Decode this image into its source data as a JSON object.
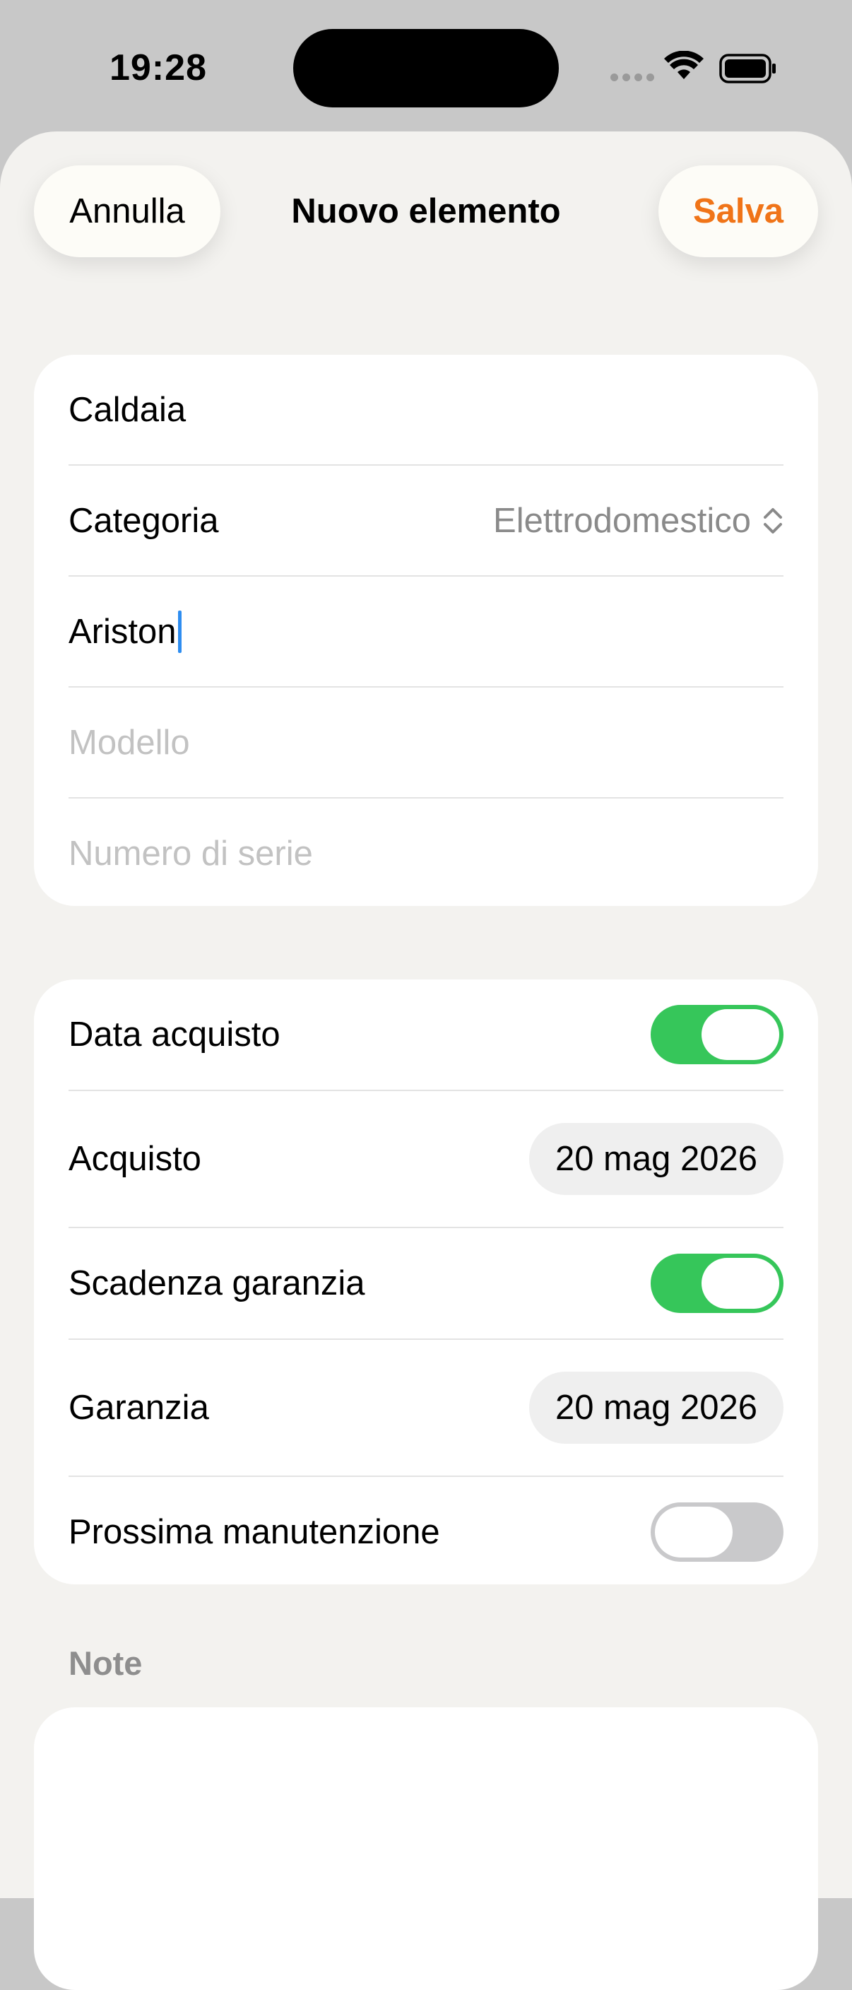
{
  "status_bar": {
    "time": "19:28",
    "signal_icon": "cellular-dots-icon",
    "wifi_icon": "wifi-icon",
    "battery_icon": "battery-icon"
  },
  "nav": {
    "cancel_label": "Annulla",
    "title": "Nuovo elemento",
    "save_label": "Salva",
    "save_color": "#f07418"
  },
  "item_card": {
    "name_value": "Caldaia",
    "category_label": "Categoria",
    "category_value": "Elettrodomestico",
    "brand_value": "Ariston",
    "model_placeholder": "Modello",
    "serial_placeholder": "Numero di serie"
  },
  "dates_card": {
    "purchase_date_toggle_label": "Data acquisto",
    "purchase_date_toggle_on": true,
    "purchase_label": "Acquisto",
    "purchase_value": "20 mag 2026",
    "warranty_toggle_label": "Scadenza garanzia",
    "warranty_toggle_on": true,
    "warranty_label": "Garanzia",
    "warranty_value": "20 mag 2026",
    "maintenance_toggle_label": "Prossima manutenzione",
    "maintenance_toggle_on": false,
    "toggle_on_color": "#36c65a"
  },
  "notes": {
    "header": "Note"
  }
}
